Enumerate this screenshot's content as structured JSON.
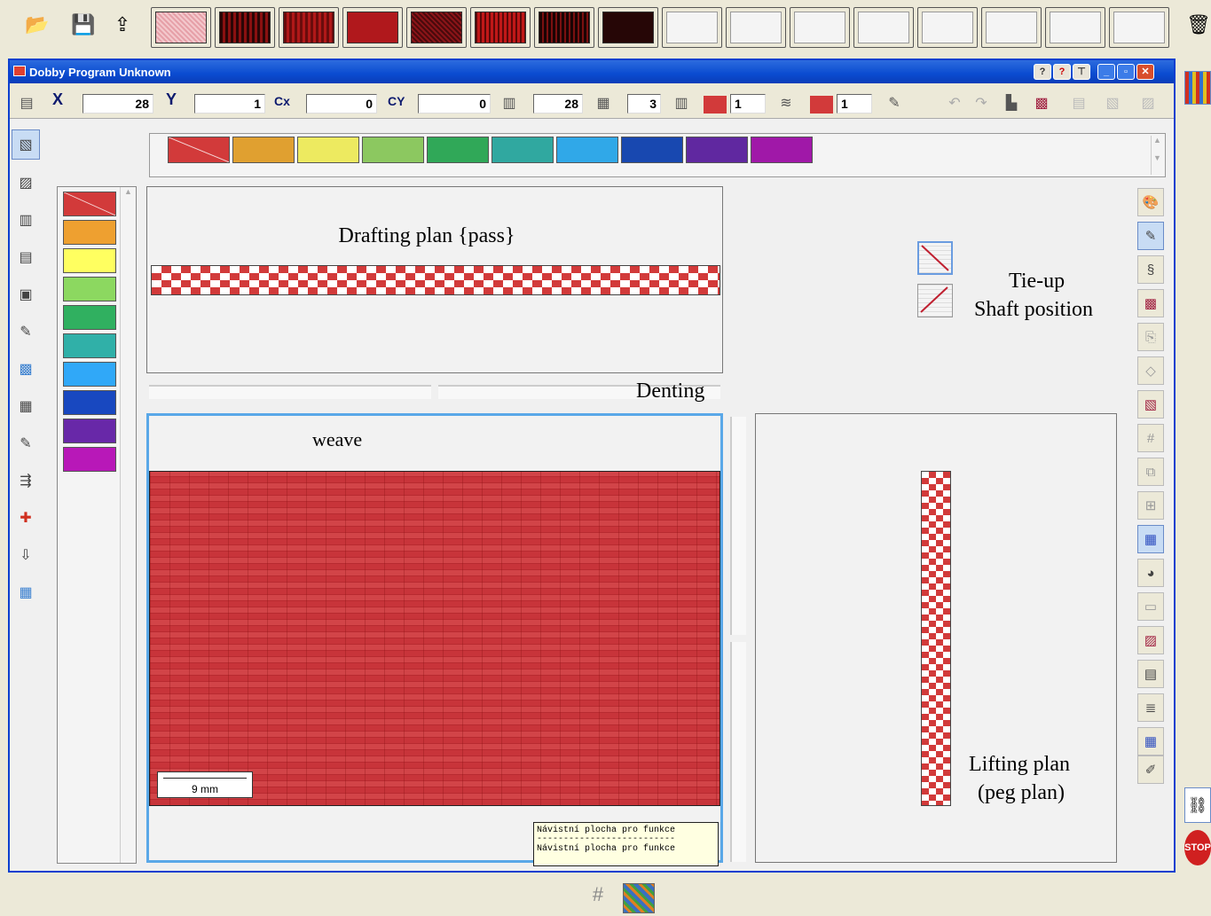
{
  "toolbar": {
    "icons": [
      "open-folder-icon",
      "save-disk-icon",
      "export-icon"
    ],
    "fabric_swatches": [
      "#E6A0A8",
      "#7A1010",
      "#9A1818",
      "#B0181C",
      "#6E1418",
      "#A01418",
      "#5A0C10",
      "#2A0606"
    ],
    "empty_slots": 8,
    "trash_icon": "recycle-bin-icon"
  },
  "window": {
    "title": "Dobby Program Unknown",
    "title_icon": "app-icon",
    "controls": [
      "help",
      "pin",
      "minimize",
      "restore",
      "close"
    ]
  },
  "coords": {
    "x_label": "X",
    "x_value": "28",
    "y_label": "Y",
    "y_value": "1",
    "cx_label": "Cx",
    "cx_value": "0",
    "cy_label": "CY",
    "cy_value": "0",
    "ends_value": "28",
    "shafts_value": "3",
    "warp_count": "1",
    "weft_count": "1"
  },
  "palette": {
    "colors": [
      "#D23A3A",
      "#E0A030",
      "#EDEA60",
      "#8CC860",
      "#30A858",
      "#30A8A0",
      "#30A8E8",
      "#1848B0",
      "#6028A0",
      "#A018A8"
    ]
  },
  "left_palette": {
    "colors": [
      "#D23A3A",
      "#EEA030",
      "#FFFF60",
      "#8CD860",
      "#30B060",
      "#30B0A8",
      "#30A8F8",
      "#1848C0",
      "#6828A8",
      "#B818B8"
    ]
  },
  "panels": {
    "drafting_label": "Drafting plan {pass}",
    "denting_label": "Denting",
    "weave_label": "weave",
    "tieup_label_1": "Tie-up",
    "tieup_label_2": "Shaft position",
    "lifting_label_1": "Lifting plan",
    "lifting_label_2": "(peg plan)",
    "scale_label": "9 mm",
    "tooltip_line1": "Návistní plocha pro funkce",
    "tooltip_sep": "--------------------------",
    "tooltip_line2": "Návistní plocha pro funkce"
  },
  "status": {
    "icons": [
      "grid-icon",
      "weave-pattern-icon"
    ]
  },
  "side": {
    "stop_label": "STOP"
  }
}
